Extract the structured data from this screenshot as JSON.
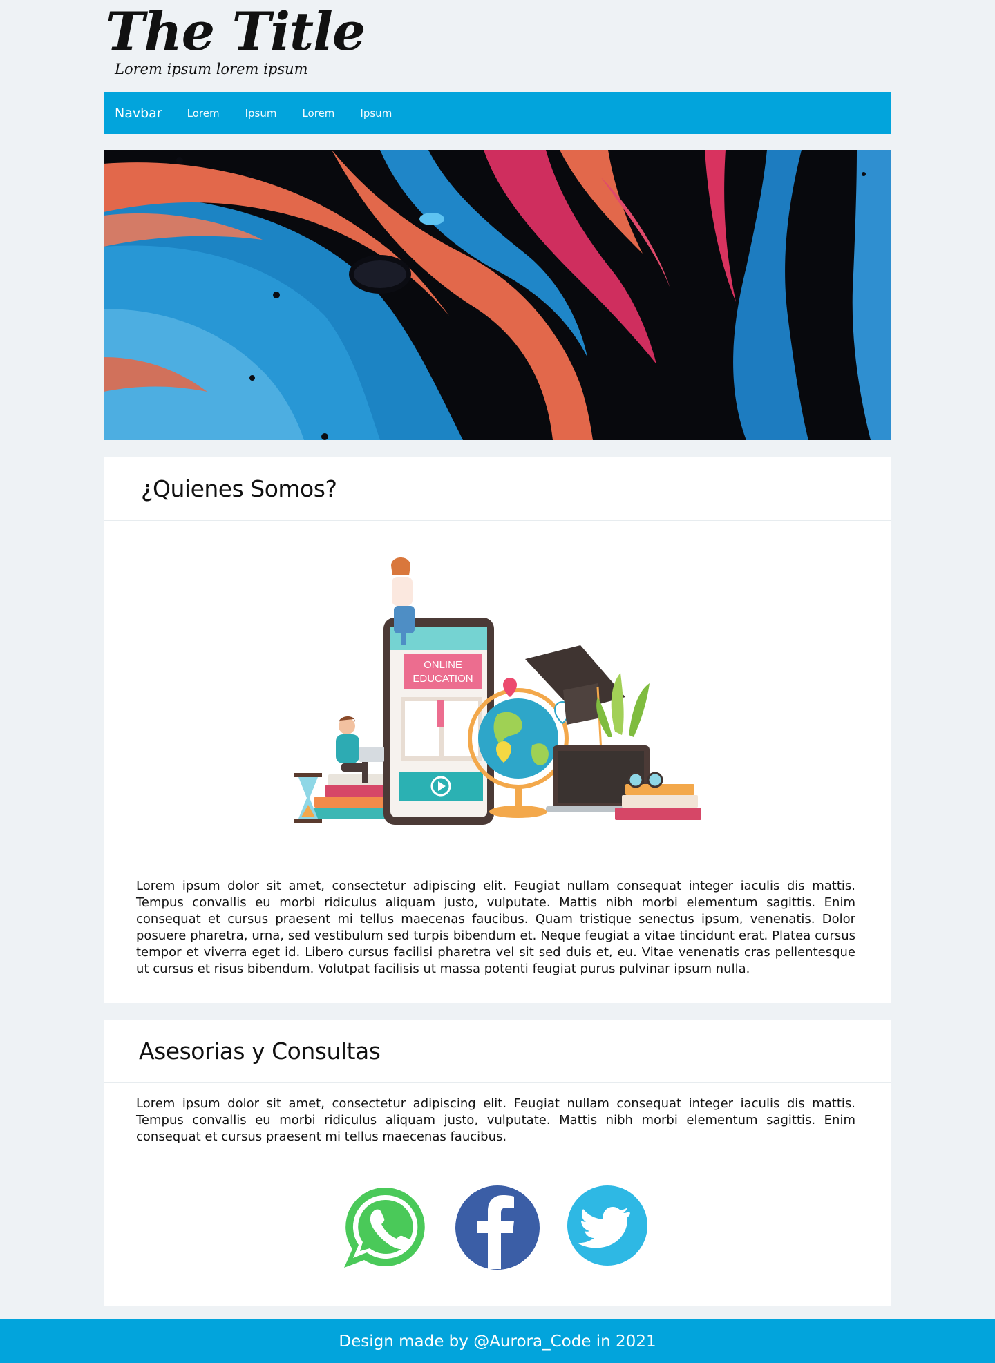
{
  "header": {
    "title": "The Title",
    "subtitle": "Lorem ipsum lorem ipsum"
  },
  "navbar": {
    "brand": "Navbar",
    "links": [
      "Lorem",
      "Ipsum",
      "Lorem",
      "Ipsum"
    ],
    "color": "#02a4dc"
  },
  "hero": {
    "description_icon": "abstract-fluid-art-banner",
    "colors": [
      "#1d86c7",
      "#e0674a",
      "#d1305f",
      "#08090d"
    ]
  },
  "about": {
    "title": "¿Quienes Somos?",
    "illustration": {
      "icon": "online-education-illustration",
      "banner_line1": "ONLINE",
      "banner_line2": "EDUCATION"
    },
    "text": "Lorem ipsum dolor sit amet, consectetur adipiscing elit. Feugiat nullam consequat integer iaculis dis mattis. Tempus convallis eu morbi ridiculus aliquam justo, vulputate. Mattis nibh morbi elementum sagittis. Enim consequat et cursus praesent mi tellus maecenas faucibus. Quam tristique senectus ipsum, venenatis. Dolor posuere pharetra, urna, sed vestibulum sed turpis bibendum et. Neque feugiat a vitae tincidunt erat. Platea cursus tempor et viverra eget id. Libero cursus facilisi pharetra vel sit sed duis et, eu. Vitae venenatis cras pellentesque ut cursus et risus bibendum. Volutpat facilisis ut massa potenti feugiat purus pulvinar ipsum nulla."
  },
  "services": {
    "title": "Asesorias y Consultas",
    "text": "Lorem ipsum dolor sit amet, consectetur adipiscing elit. Feugiat nullam consequat integer iaculis dis mattis. Tempus convallis eu morbi ridiculus aliquam justo, vulputate. Mattis nibh morbi elementum sagittis. Enim consequat et cursus praesent mi tellus maecenas faucibus.",
    "social": [
      {
        "icon": "whatsapp-icon",
        "color": "#4ac959"
      },
      {
        "icon": "facebook-icon",
        "color": "#3b5ea6"
      },
      {
        "icon": "twitter-icon",
        "color": "#2eb8e4"
      }
    ]
  },
  "footer": {
    "text": "Design made by @Aurora_Code in 2021"
  }
}
